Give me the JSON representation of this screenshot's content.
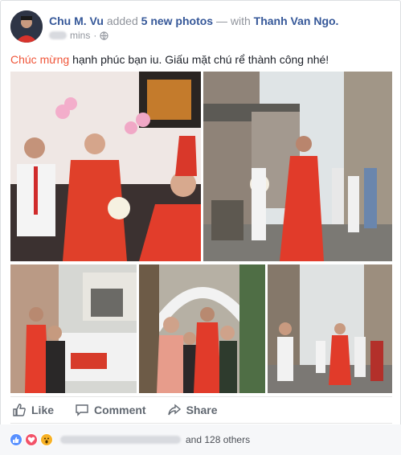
{
  "post": {
    "author": "Chu M. Vu",
    "action_text": "added",
    "photo_count_text": "5 new photos",
    "with_text": "— with",
    "tagged": "Thanh Van Ngo.",
    "time_text": "mins",
    "caption_highlight": "Chúc mừng",
    "caption_rest": "hạnh phúc bạn iu. Giấu mặt chú rể thành công nhé!"
  },
  "actions": {
    "like": "Like",
    "comment": "Comment",
    "share": "Share"
  },
  "reactions": {
    "others_text": "and 128 others",
    "icons": [
      "like-icon",
      "love-icon",
      "wow-icon"
    ],
    "colors": {
      "like": "#5890ff",
      "love": "#f25268",
      "wow": "#f7b125"
    }
  },
  "colors": {
    "link": "#365899",
    "highlight": "#f0563a",
    "muted": "#90949c"
  }
}
